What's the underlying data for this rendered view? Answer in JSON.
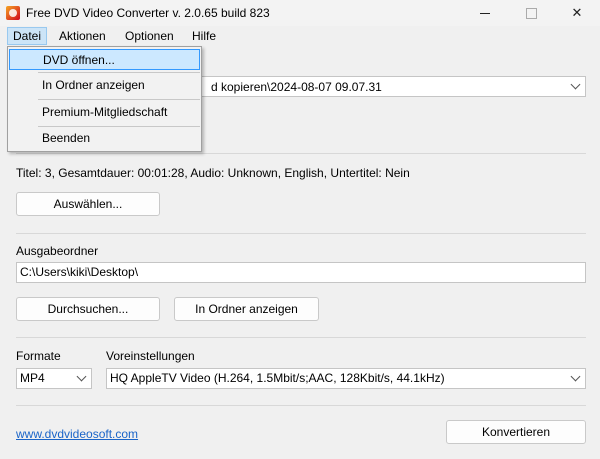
{
  "window": {
    "title": "Free DVD Video Converter  v. 2.0.65 build 823",
    "minimize_symbol": "—",
    "close_symbol": "✕"
  },
  "menubar": {
    "items": [
      "Datei",
      "Aktionen",
      "Optionen",
      "Hilfe"
    ],
    "active": "Datei"
  },
  "dropdown": {
    "items": [
      "DVD öffnen...",
      "In Ordner anzeigen",
      "Premium-Mitgliedschaft",
      "Beenden"
    ],
    "highlighted": "DVD öffnen..."
  },
  "source": {
    "path_visible": "d kopieren\\2024-08-07 09.07.31"
  },
  "title_info": {
    "text": "Titel: 3, Gesamtdauer: 00:01:28, Audio: Unknown, English, Untertitel: Nein",
    "select_button": "Auswählen..."
  },
  "output": {
    "label": "Ausgabeordner",
    "folder": "C:\\Users\\kiki\\Desktop\\",
    "browse_button": "Durchsuchen...",
    "show_button": "In Ordner anzeigen"
  },
  "format": {
    "label": "Formate",
    "value": "MP4",
    "preset_label": "Voreinstellungen",
    "preset_value": "HQ AppleTV Video (H.264, 1.5Mbit/s;AAC, 128Kbit/s, 44.1kHz)"
  },
  "footer": {
    "link": "www.dvdvideosoft.com",
    "convert_button": "Konvertieren"
  }
}
